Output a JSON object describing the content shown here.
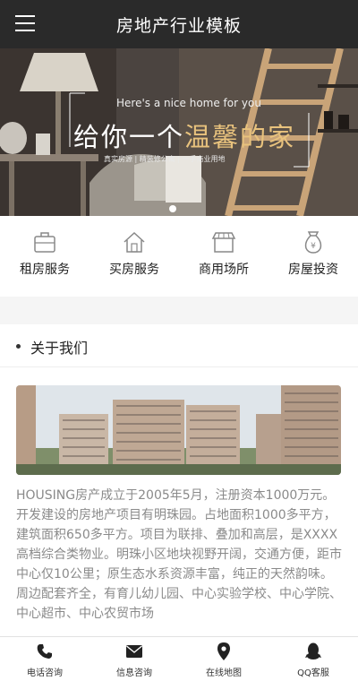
{
  "header": {
    "title": "房地产行业模板"
  },
  "banner": {
    "subtitle": "Here's a nice home for you",
    "title_prefix": "给你一个",
    "title_highlight": "温馨的家",
    "tagline": "真实房源 | 精装修公寓 | 一手商业用地"
  },
  "services": [
    {
      "label": "租房服务",
      "icon": "suitcase-icon"
    },
    {
      "label": "买房服务",
      "icon": "house-icon"
    },
    {
      "label": "商用场所",
      "icon": "storefront-icon"
    },
    {
      "label": "房屋投资",
      "icon": "money-bag-icon"
    }
  ],
  "about": {
    "title": "关于我们",
    "text": "HOUSING房产成立于2005年5月，注册资本1000万元。开发建设的房地产项目有明珠园。占地面积1000多平方，建筑面积650多平方。项目为联排、叠加和高层，是XXXX高档综合类物业。明珠小区地块视野开阔，交通方便，距市中心仅10公里；原生态水系资源丰富，纯正的天然韵味。周边配套齐全，有育儿幼儿园、中心实验学校、中心学院、中心超市、中心农贸市场"
  },
  "bottom_nav": [
    {
      "label": "电话咨询",
      "icon": "phone-icon"
    },
    {
      "label": "信息咨询",
      "icon": "envelope-icon"
    },
    {
      "label": "在线地图",
      "icon": "map-pin-icon"
    },
    {
      "label": "QQ客服",
      "icon": "qq-penguin-icon"
    }
  ],
  "colors": {
    "header_bg": "#2a2a2a",
    "highlight": "#e8c27d",
    "body_text": "#8a8a8a"
  }
}
